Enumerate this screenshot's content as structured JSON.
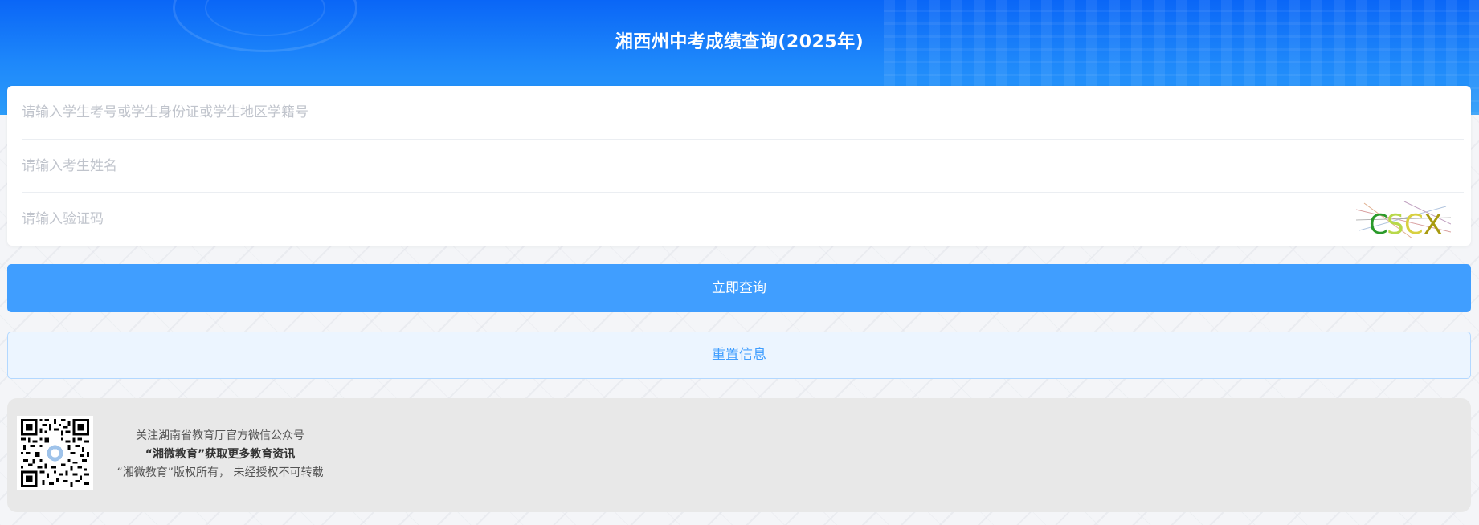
{
  "header": {
    "title": "湘西州中考成绩查询(2025年)",
    "background_color": "#1e88fa"
  },
  "form": {
    "id_placeholder": "请输入学生考号或学生身份证或学生地区学籍号",
    "name_placeholder": "请输入考生姓名",
    "captcha_placeholder": "请输入验证码",
    "captcha_text": "CSCX"
  },
  "actions": {
    "submit_label": "立即查询",
    "reset_label": "重置信息",
    "primary_color": "#409eff"
  },
  "footer": {
    "line1": "关注湖南省教育厅官方微信公众号",
    "line2": "“湘微教育”获取更多教育资讯",
    "line3": "“湘微教育”版权所有， 未经授权不可转载",
    "qr_icon": "qr-code-icon"
  }
}
